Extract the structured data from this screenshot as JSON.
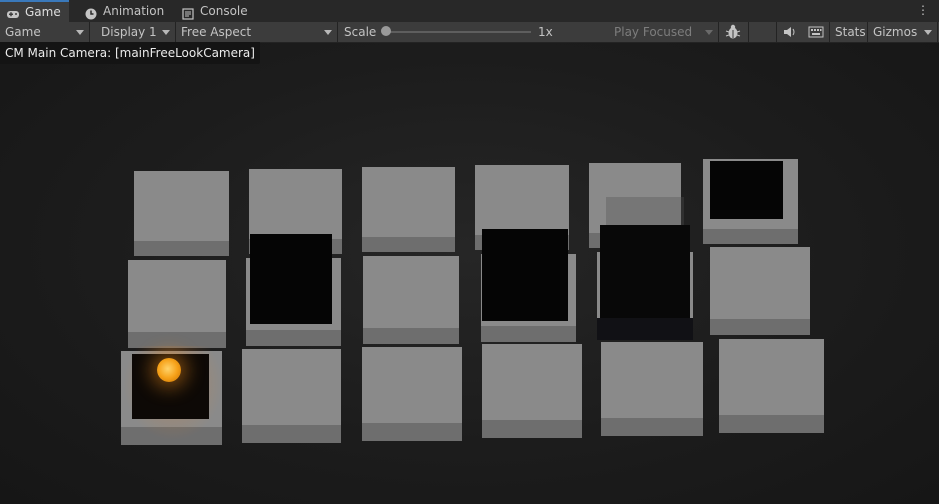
{
  "tabs": [
    {
      "label": "Game",
      "icon": "gamepad-icon",
      "active": true
    },
    {
      "label": "Animation",
      "icon": "clock-icon",
      "active": false
    },
    {
      "label": "Console",
      "icon": "console-icon",
      "active": false
    }
  ],
  "toolbar": {
    "mode": "Game",
    "display": "Display 1",
    "aspect": "Free Aspect",
    "scale_label": "Scale",
    "scale_value": "1x",
    "play_mode": "Play Focused",
    "stats_label": "Stats",
    "gizmos_label": "Gizmos"
  },
  "scene": {
    "camera_label": "CM Main Camera: [mainFreeLookCamera]",
    "colors": {
      "tile": "#8a8a8a",
      "block": "#050505",
      "ball": "#f6a21a"
    }
  }
}
